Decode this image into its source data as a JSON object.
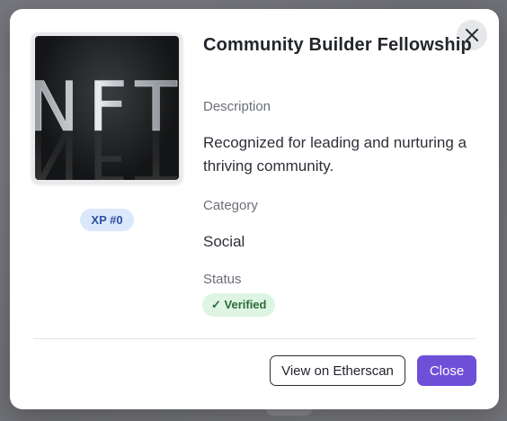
{
  "modal": {
    "title": "Community Builder Fellowship",
    "image": {
      "text": "NFT"
    },
    "xp_badge": "XP #0",
    "description": {
      "label": "Description",
      "value": "Recognized for leading and nurturing a thriving community."
    },
    "category": {
      "label": "Category",
      "value": "Social"
    },
    "status": {
      "label": "Status",
      "badge": "✓ Verified"
    },
    "buttons": {
      "etherscan": "View on Etherscan",
      "close": "Close"
    },
    "icons": {
      "close": "close-icon"
    },
    "colors": {
      "primary": "#6e4fd8",
      "xp_badge_bg": "#dbe7fb",
      "verified_bg": "#ddf5e2"
    }
  }
}
